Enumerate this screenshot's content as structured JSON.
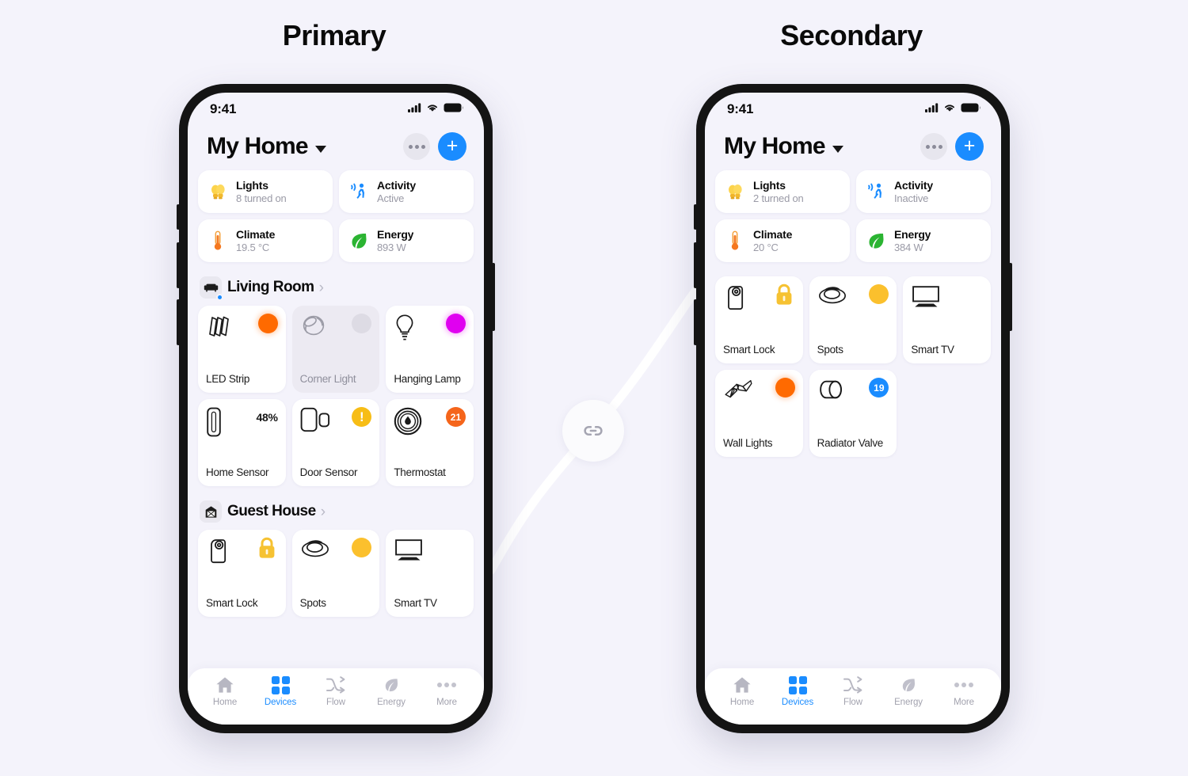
{
  "captions": {
    "primary": "Primary",
    "secondary": "Secondary"
  },
  "connector": {
    "icon": "link-icon"
  },
  "colors": {
    "background": "#f4f3fb",
    "accent": "#1a8cff",
    "orange": "#ff6a00",
    "magenta": "#e000f0",
    "yellow": "#fbc02d",
    "warn": "#f7bd16",
    "badge_orange": "#f5651b",
    "card": "#ffffff",
    "muted_text": "#9a9aa6"
  },
  "phones": [
    {
      "id": "primary",
      "statusbar": {
        "time": "9:41",
        "icons": [
          "cellular-icon",
          "wifi-icon",
          "battery-icon"
        ]
      },
      "header": {
        "title": "My Home",
        "caret": "chevron-down-icon",
        "more_label": "more-options",
        "add_label": "+"
      },
      "summary": [
        {
          "icon": "bulb-icon",
          "title": "Lights",
          "sub": "8 turned on"
        },
        {
          "icon": "motion-icon",
          "title": "Activity",
          "sub": "Active"
        },
        {
          "icon": "thermometer-icon",
          "title": "Climate",
          "sub": "19.5 °C"
        },
        {
          "icon": "leaf-icon",
          "title": "Energy",
          "sub": "893 W"
        }
      ],
      "rooms": [
        {
          "name": "Living Room",
          "icon": "sofa-icon",
          "online": true,
          "devices": [
            {
              "name": "LED Strip",
              "icon": "led-strip-icon",
              "badge": {
                "type": "dot-orange"
              },
              "state": "on"
            },
            {
              "name": "Corner Light",
              "icon": "spotlight-icon",
              "badge": {
                "type": "dot-grey"
              },
              "state": "off"
            },
            {
              "name": "Hanging Lamp",
              "icon": "bulb-outline-icon",
              "badge": {
                "type": "dot-magenta"
              },
              "state": "on"
            },
            {
              "name": "Home Sensor",
              "icon": "sensor-icon",
              "badge": {
                "type": "text-only",
                "value": "48%"
              },
              "state": "on"
            },
            {
              "name": "Door Sensor",
              "icon": "door-sensor-icon",
              "badge": {
                "type": "warn",
                "value": "!"
              },
              "state": "on"
            },
            {
              "name": "Thermostat",
              "icon": "thermostat-icon",
              "badge": {
                "type": "num-orange",
                "value": "21"
              },
              "state": "on"
            }
          ]
        },
        {
          "name": "Guest House",
          "icon": "house-icon",
          "online": false,
          "devices": [
            {
              "name": "Smart Lock",
              "icon": "smart-lock-icon",
              "badge": {
                "type": "lock"
              },
              "state": "on"
            },
            {
              "name": "Spots",
              "icon": "spots-icon",
              "badge": {
                "type": "dot-yellow"
              },
              "state": "on"
            },
            {
              "name": "Smart TV",
              "icon": "tv-icon",
              "badge": {
                "type": "none"
              },
              "state": "on"
            }
          ]
        }
      ],
      "tabs": [
        {
          "label": "Home",
          "icon": "home-icon",
          "active": false
        },
        {
          "label": "Devices",
          "icon": "grid-icon",
          "active": true
        },
        {
          "label": "Flow",
          "icon": "flow-icon",
          "active": false
        },
        {
          "label": "Energy",
          "icon": "leaf-icon",
          "active": false
        },
        {
          "label": "More",
          "icon": "ellipsis-icon",
          "active": false
        }
      ]
    },
    {
      "id": "secondary",
      "statusbar": {
        "time": "9:41",
        "icons": [
          "cellular-icon",
          "wifi-icon",
          "battery-icon"
        ]
      },
      "header": {
        "title": "My Home",
        "caret": "chevron-down-icon",
        "more_label": "more-options",
        "add_label": "+"
      },
      "summary": [
        {
          "icon": "bulb-icon",
          "title": "Lights",
          "sub": "2 turned on"
        },
        {
          "icon": "motion-icon",
          "title": "Activity",
          "sub": "Inactive"
        },
        {
          "icon": "thermometer-icon",
          "title": "Climate",
          "sub": "20 °C"
        },
        {
          "icon": "leaf-icon",
          "title": "Energy",
          "sub": "384 W"
        }
      ],
      "rooms": [
        {
          "name": "",
          "icon": "",
          "online": false,
          "devices": [
            {
              "name": "Smart Lock",
              "icon": "smart-lock-icon",
              "badge": {
                "type": "lock"
              },
              "state": "on"
            },
            {
              "name": "Spots",
              "icon": "spots-icon",
              "badge": {
                "type": "dot-yellow"
              },
              "state": "on"
            },
            {
              "name": "Smart TV",
              "icon": "tv-icon",
              "badge": {
                "type": "none"
              },
              "state": "on"
            },
            {
              "name": "Wall Lights",
              "icon": "wall-lights-icon",
              "badge": {
                "type": "dot-orange"
              },
              "state": "on"
            },
            {
              "name": "Radiator Valve",
              "icon": "radiator-valve-icon",
              "badge": {
                "type": "num-blue",
                "value": "19"
              },
              "state": "on"
            }
          ]
        }
      ],
      "tabs": [
        {
          "label": "Home",
          "icon": "home-icon",
          "active": false
        },
        {
          "label": "Devices",
          "icon": "grid-icon",
          "active": true
        },
        {
          "label": "Flow",
          "icon": "flow-icon",
          "active": false
        },
        {
          "label": "Energy",
          "icon": "leaf-icon",
          "active": false
        },
        {
          "label": "More",
          "icon": "ellipsis-icon",
          "active": false
        }
      ]
    }
  ]
}
